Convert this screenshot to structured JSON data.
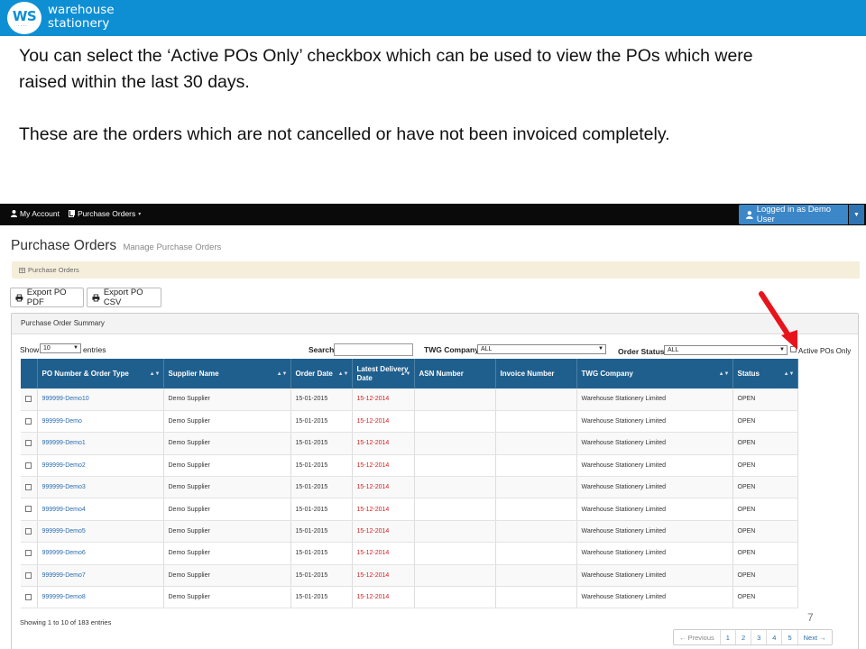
{
  "brand": {
    "logo_text": "WS",
    "logo_dots": "....",
    "line1": "warehouse",
    "line2": "stationery"
  },
  "caption": {
    "line1": "You can select the ‘Active POs Only’ checkbox which can be used to view the POs which were",
    "line2": "raised within the last 30 days.",
    "line3": "These are the orders which are not cancelled or have not been invoiced completely."
  },
  "nav": {
    "my_account": "My Account",
    "purchase_orders": "Purchase Orders",
    "logged_in": "Logged in as Demo User"
  },
  "page": {
    "title": "Purchase Orders",
    "subtitle": "Manage Purchase Orders",
    "breadcrumb": "Purchase Orders"
  },
  "export": {
    "pdf": "Export PO PDF",
    "csv": "Export PO CSV"
  },
  "panel": {
    "title": "Purchase Order Summary"
  },
  "controls": {
    "show_label": "Show",
    "show_value": "10",
    "entries_label": "entries",
    "search_label": "Search:",
    "twg_label": "TWG Company",
    "twg_value": "ALL",
    "status_label": "Order Status",
    "status_value": "ALL",
    "active_label": "Active POs Only"
  },
  "table": {
    "headers": [
      "PO Number & Order Type",
      "Supplier Name",
      "Order Date",
      "Latest Delivery Date",
      "ASN Number",
      "Invoice Number",
      "TWG Company",
      "Status"
    ],
    "rows": [
      {
        "po": "999999-Demo10",
        "supplier": "Demo Supplier",
        "order_date": "15-01-2015",
        "delivery": "15-12-2014",
        "asn": "",
        "invoice": "",
        "company": "Warehouse Stationery Limited",
        "status": "OPEN"
      },
      {
        "po": "999999-Demo",
        "supplier": "Demo Supplier",
        "order_date": "15-01-2015",
        "delivery": "15-12-2014",
        "asn": "",
        "invoice": "",
        "company": "Warehouse Stationery Limited",
        "status": "OPEN"
      },
      {
        "po": "999999-Demo1",
        "supplier": "Demo Supplier",
        "order_date": "15-01-2015",
        "delivery": "15-12-2014",
        "asn": "",
        "invoice": "",
        "company": "Warehouse Stationery Limited",
        "status": "OPEN"
      },
      {
        "po": "999999-Demo2",
        "supplier": "Demo Supplier",
        "order_date": "15-01-2015",
        "delivery": "15-12-2014",
        "asn": "",
        "invoice": "",
        "company": "Warehouse Stationery Limited",
        "status": "OPEN"
      },
      {
        "po": "999999-Demo3",
        "supplier": "Demo Supplier",
        "order_date": "15-01-2015",
        "delivery": "15-12-2014",
        "asn": "",
        "invoice": "",
        "company": "Warehouse Stationery Limited",
        "status": "OPEN"
      },
      {
        "po": "999999-Demo4",
        "supplier": "Demo Supplier",
        "order_date": "15-01-2015",
        "delivery": "15-12-2014",
        "asn": "",
        "invoice": "",
        "company": "Warehouse Stationery Limited",
        "status": "OPEN"
      },
      {
        "po": "999999-Demo5",
        "supplier": "Demo Supplier",
        "order_date": "15-01-2015",
        "delivery": "15-12-2014",
        "asn": "",
        "invoice": "",
        "company": "Warehouse Stationery Limited",
        "status": "OPEN"
      },
      {
        "po": "999999-Demo6",
        "supplier": "Demo Supplier",
        "order_date": "15-01-2015",
        "delivery": "15-12-2014",
        "asn": "",
        "invoice": "",
        "company": "Warehouse Stationery Limited",
        "status": "OPEN"
      },
      {
        "po": "999999-Demo7",
        "supplier": "Demo Supplier",
        "order_date": "15-01-2015",
        "delivery": "15-12-2014",
        "asn": "",
        "invoice": "",
        "company": "Warehouse Stationery Limited",
        "status": "OPEN"
      },
      {
        "po": "999999-Demo8",
        "supplier": "Demo Supplier",
        "order_date": "15-01-2015",
        "delivery": "15-12-2014",
        "asn": "",
        "invoice": "",
        "company": "Warehouse Stationery Limited",
        "status": "OPEN"
      }
    ]
  },
  "footer": {
    "showing": "Showing 1 to 10 of 183 entries"
  },
  "pagination": [
    "← Previous",
    "1",
    "2",
    "3",
    "4",
    "5",
    "Next →"
  ],
  "slide_number": "7",
  "icons": {
    "user": "user-icon",
    "document": "document-icon",
    "print": "print-icon",
    "table": "table-icon",
    "caret": "caret-down-icon",
    "sort": "sort-icon",
    "arrow": "red-arrow-icon"
  },
  "colors": {
    "brand_blue": "#0e8fd4",
    "nav_black": "#0a0a0a",
    "header_blue": "#1f5f8e",
    "logged_btn": "#3c87c8",
    "breadcrumb_bg": "#f5eedb",
    "link": "#2a6cb0",
    "date_red": "#d42020",
    "arrow_red": "#e8141c"
  }
}
